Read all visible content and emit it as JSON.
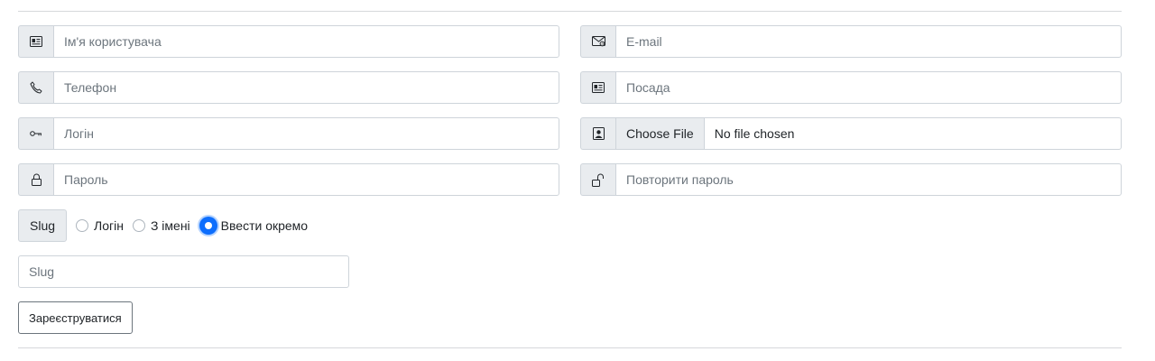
{
  "form": {
    "username": {
      "icon": "id-card-icon",
      "placeholder": "Ім'я користувача"
    },
    "email": {
      "icon": "envelope-icon",
      "placeholder": "E-mail"
    },
    "phone": {
      "icon": "telephone-icon",
      "placeholder": "Телефон"
    },
    "position": {
      "icon": "id-card-icon",
      "placeholder": "Посада"
    },
    "login": {
      "icon": "key-icon",
      "placeholder": "Логін"
    },
    "photo": {
      "icon": "person-badge-icon",
      "button_label": "Choose File",
      "status": "No file chosen"
    },
    "password": {
      "icon": "lock-icon",
      "placeholder": "Пароль"
    },
    "password_repeat": {
      "icon": "unlock-icon",
      "placeholder": "Повторити пароль"
    },
    "slug": {
      "label": "Slug",
      "options": [
        {
          "label": "Логін",
          "checked": false
        },
        {
          "label": "З імені",
          "checked": false
        },
        {
          "label": "Ввести окремо",
          "checked": true
        }
      ],
      "placeholder": "Slug"
    },
    "submit_label": "Зареєструватися"
  },
  "colors": {
    "accent": "#0d6efd",
    "addon_bg": "#e9ecef",
    "border": "#ced4da"
  }
}
